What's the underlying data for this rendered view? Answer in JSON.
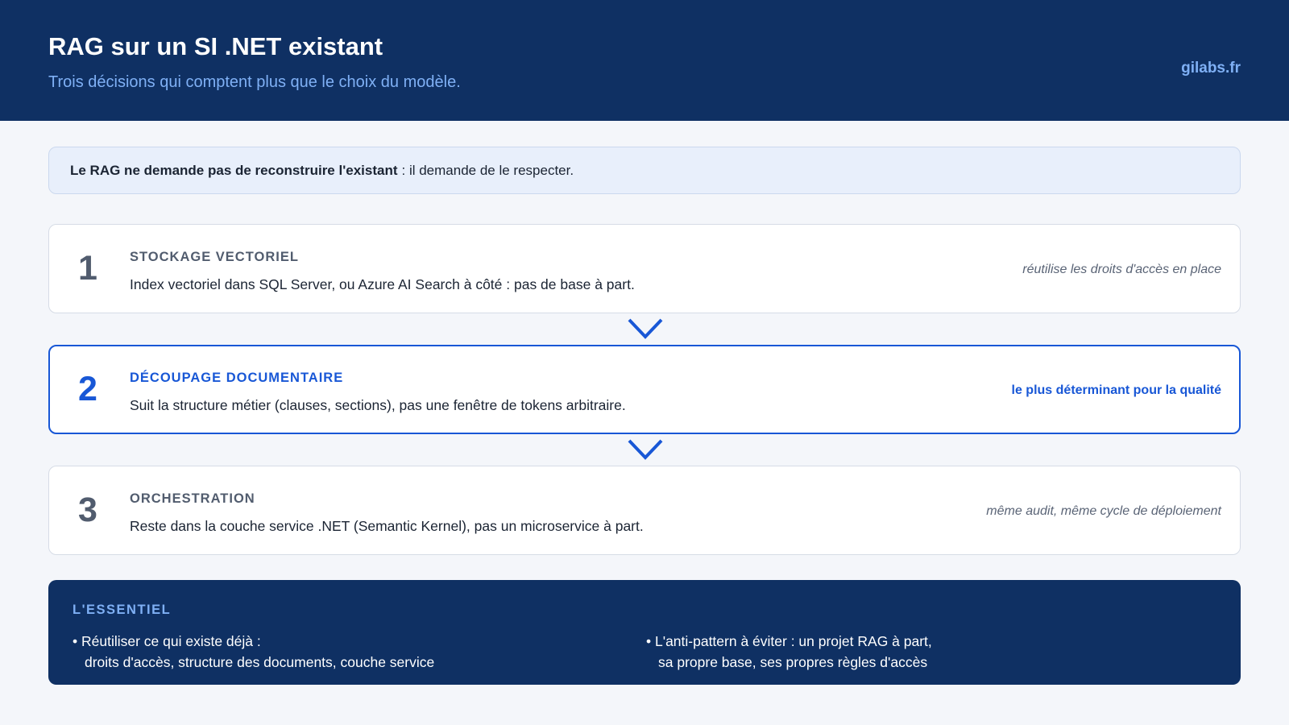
{
  "header": {
    "title": "RAG sur un SI .NET existant",
    "subtitle": "Trois décisions qui comptent plus que le choix du modèle.",
    "brand": "gilabs.fr"
  },
  "callout": {
    "bold": "Le RAG ne demande pas de reconstruire l'existant",
    "rest": ": il demande de le respecter."
  },
  "steps": [
    {
      "number": "1",
      "heading": "STOCKAGE VECTORIEL",
      "description": "Index vectoriel dans SQL Server, ou Azure AI Search à côté : pas de base à part.",
      "note": "réutilise les droits d'accès en place"
    },
    {
      "number": "2",
      "heading": "DÉCOUPAGE DOCUMENTAIRE",
      "description": "Suit la structure métier (clauses, sections), pas une fenêtre de tokens arbitraire.",
      "note": "le plus déterminant pour la qualité"
    },
    {
      "number": "3",
      "heading": "ORCHESTRATION",
      "description": "Reste dans la couche service .NET (Semantic Kernel), pas un microservice à part.",
      "note": "même audit, même cycle de déploiement"
    }
  ],
  "summary": {
    "title": "L'ESSENTIEL",
    "left": {
      "line1": "• Réutiliser ce qui existe déjà :",
      "line2": "droits d'accès, structure des documents, couche service"
    },
    "right": {
      "line1": "• L'anti-pattern à éviter : un projet RAG à part,",
      "line2": "sa propre base, ses propres règles d'accès"
    }
  },
  "colors": {
    "navy": "#0f3063",
    "accent": "#1857d6",
    "light_blue": "#7fb0f5",
    "background": "#f4f6fa"
  },
  "icons": [
    "chevron-down-icon",
    "chevron-down-icon"
  ]
}
